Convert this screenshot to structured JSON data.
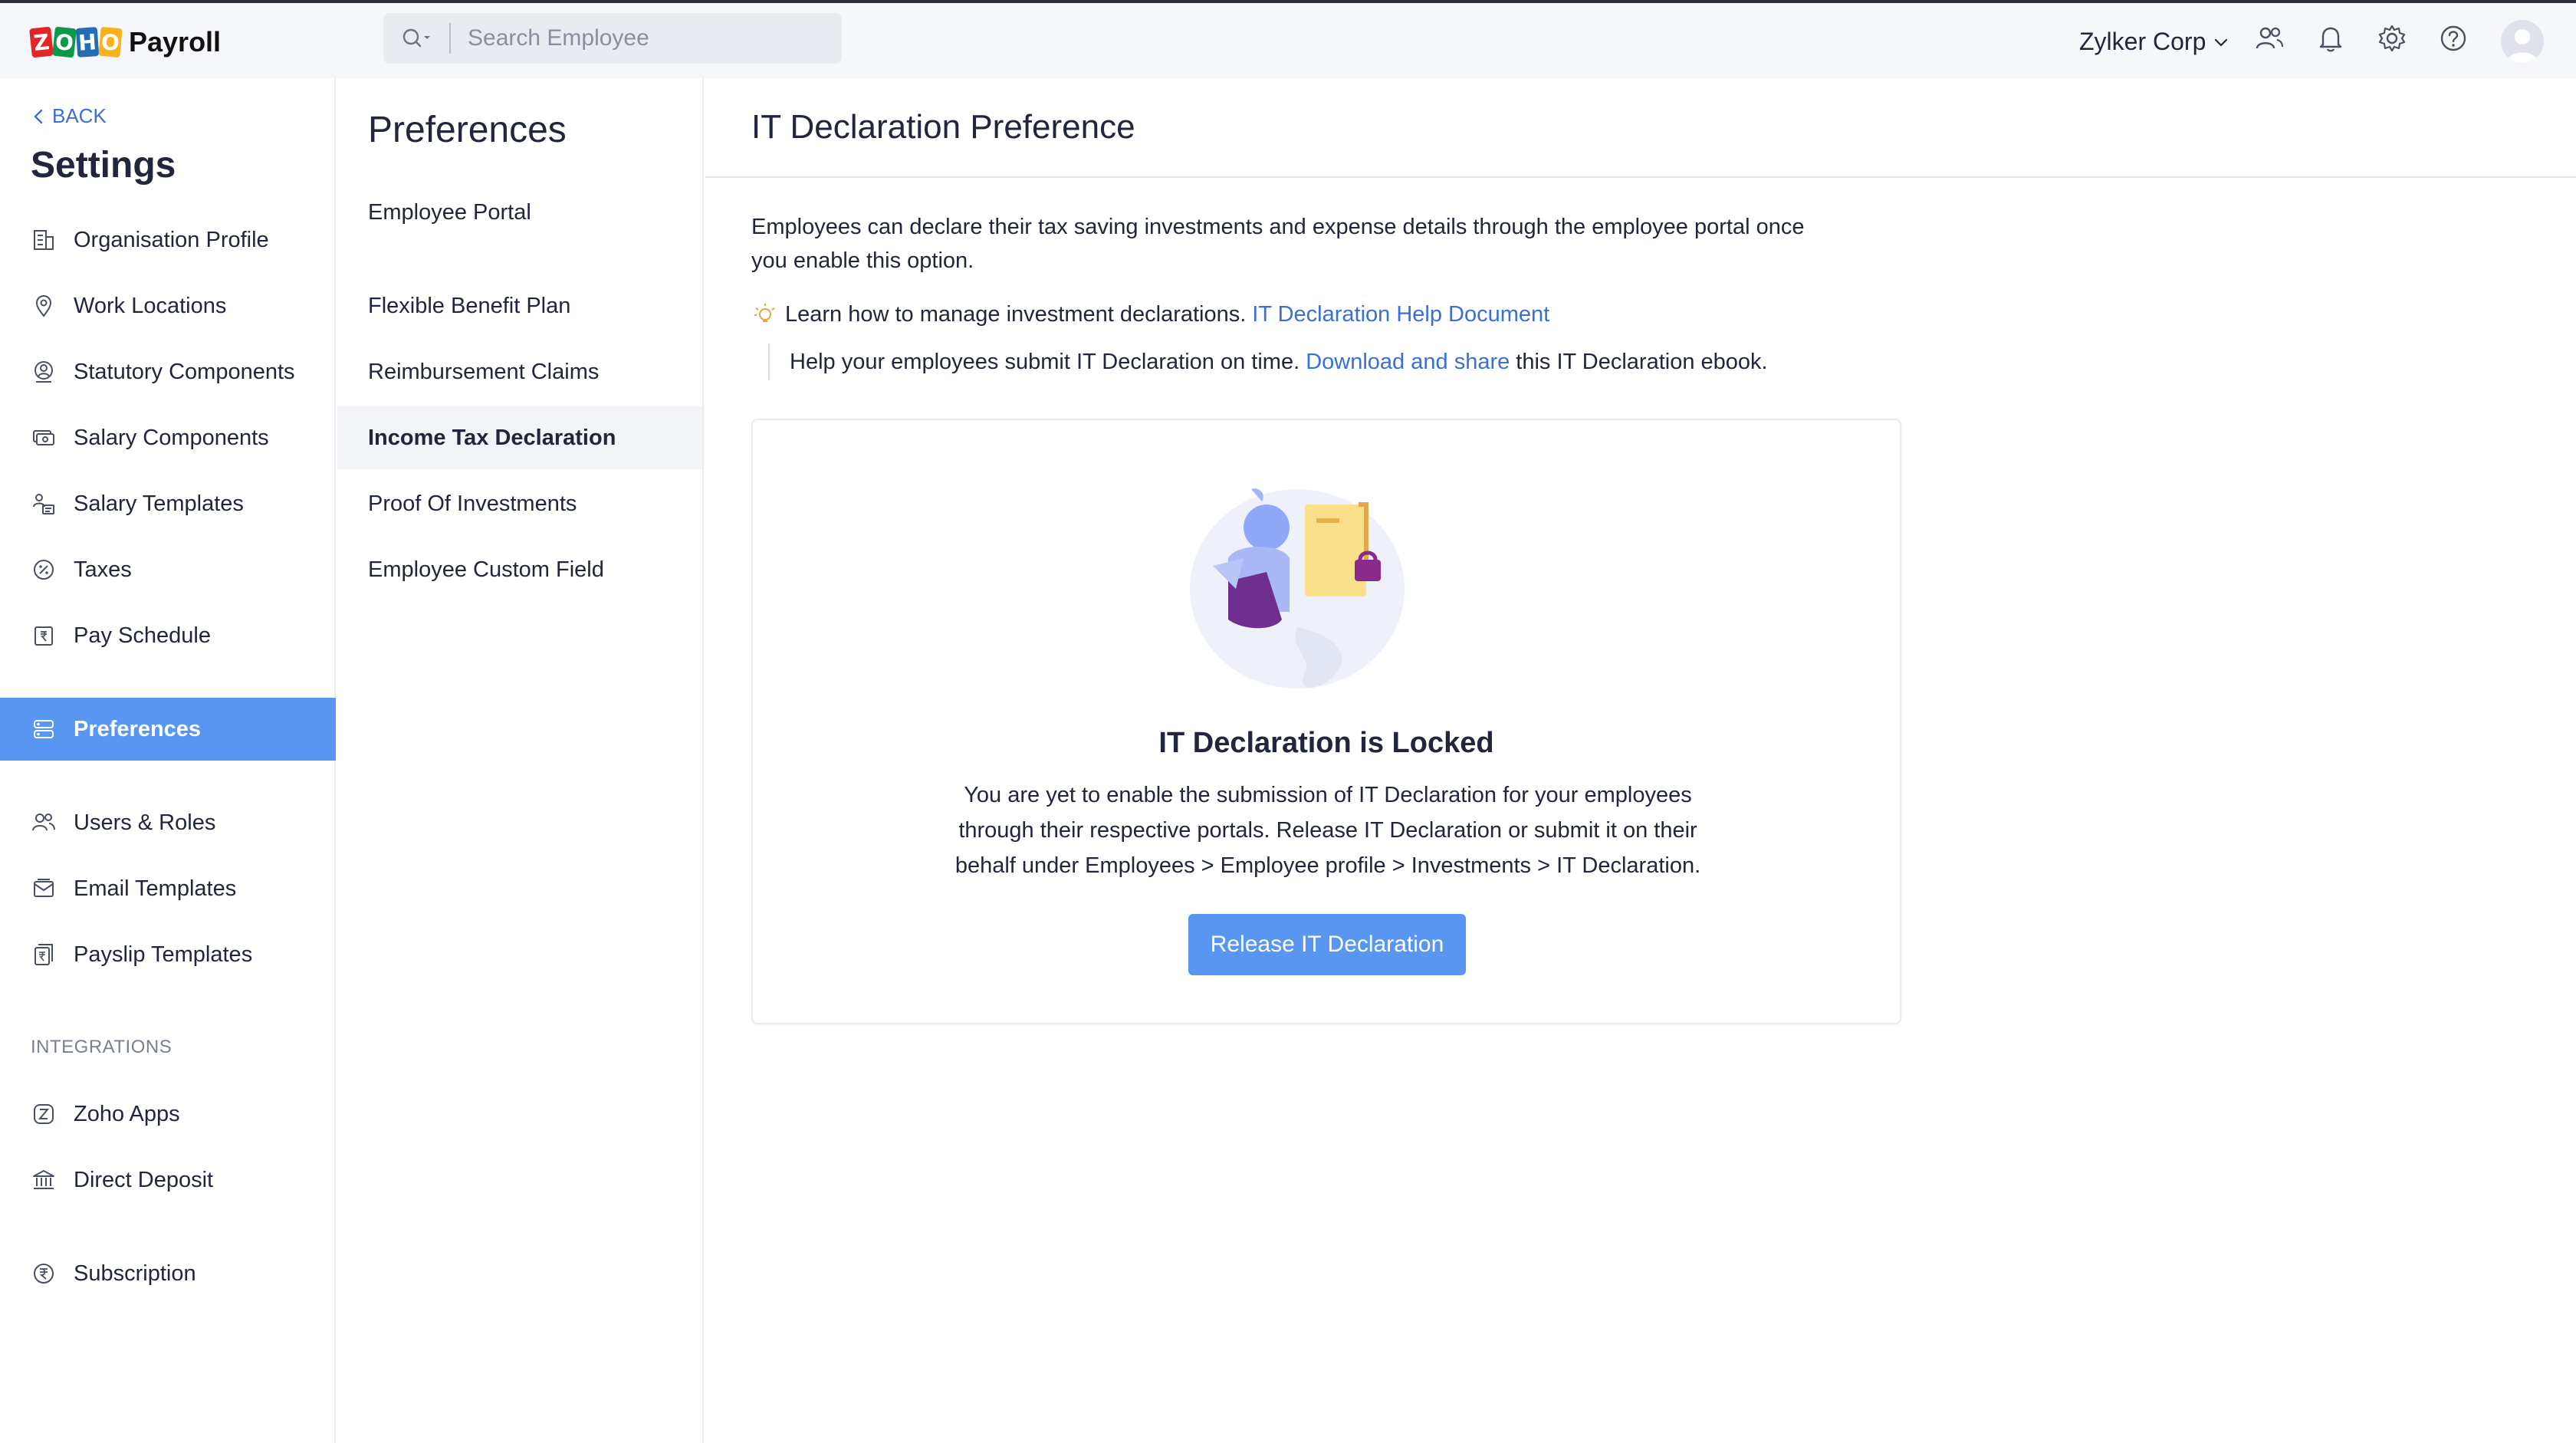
{
  "header": {
    "app_name": "Payroll",
    "logo_letters": [
      "Z",
      "O",
      "H",
      "O"
    ],
    "search_placeholder": "Search Employee",
    "org_name": "Zylker Corp",
    "icons": [
      "users-icon",
      "bell-icon",
      "gear-icon",
      "help-icon",
      "avatar"
    ]
  },
  "sidebar": {
    "back_label": "BACK",
    "title": "Settings",
    "items": [
      {
        "label": "Organisation Profile",
        "icon": "building-icon"
      },
      {
        "label": "Work Locations",
        "icon": "location-pin-icon"
      },
      {
        "label": "Statutory Components",
        "icon": "shield-user-icon"
      },
      {
        "label": "Salary Components",
        "icon": "money-icon"
      },
      {
        "label": "Salary Templates",
        "icon": "template-icon"
      },
      {
        "label": "Taxes",
        "icon": "percent-icon"
      },
      {
        "label": "Pay Schedule",
        "icon": "rupee-calendar-icon"
      },
      {
        "label": "Preferences",
        "icon": "preferences-icon"
      },
      {
        "label": "Users & Roles",
        "icon": "users-icon"
      },
      {
        "label": "Email Templates",
        "icon": "mail-icon"
      },
      {
        "label": "Payslip Templates",
        "icon": "payslip-icon"
      },
      {
        "label": "Zoho Apps",
        "icon": "zoho-apps-icon"
      },
      {
        "label": "Direct Deposit",
        "icon": "bank-icon"
      },
      {
        "label": "Subscription",
        "icon": "rupee-circle-icon"
      }
    ],
    "integrations_label": "INTEGRATIONS",
    "active_color": "#5996f2"
  },
  "preferences_panel": {
    "title": "Preferences",
    "items": [
      "Employee Portal",
      "Flexible Benefit Plan",
      "Reimbursement Claims",
      "Income Tax Declaration",
      "Proof Of Investments",
      "Employee Custom Field"
    ]
  },
  "main": {
    "title": "IT Declaration Preference",
    "intro": "Employees can declare their tax saving investments and expense details through the employee portal once you enable this option.",
    "tip1_text": "Learn how to manage investment declarations.",
    "tip1_link": "IT Declaration Help Document",
    "tip2_before": "Help your employees submit IT Declaration on time.",
    "tip2_link": "Download and share",
    "tip2_after": "this IT Declaration ebook.",
    "card": {
      "title": "IT Declaration is Locked",
      "description": "You are yet to enable the submission of IT Declaration for your employees through their respective portals. Release IT Declaration or submit it on their behalf under Employees > Employee profile > Investments > IT Declaration.",
      "button_label": "Release IT Declaration"
    },
    "link_color": "#3a6fd8"
  }
}
